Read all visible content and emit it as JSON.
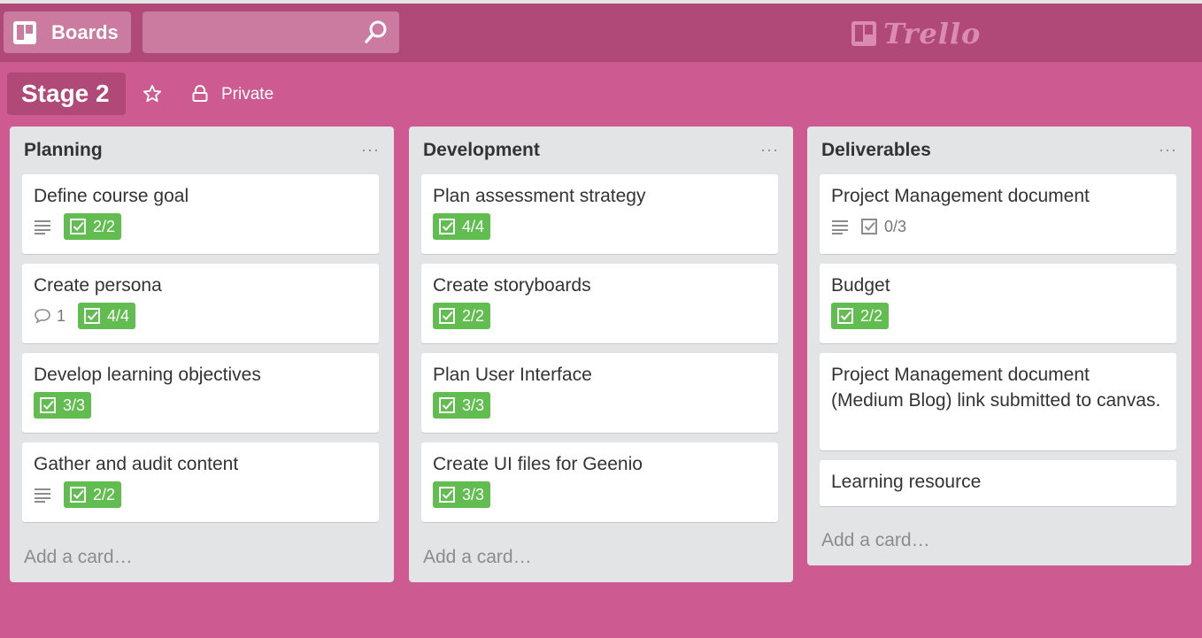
{
  "header": {
    "boards_label": "Boards",
    "search_placeholder": "",
    "logo_text": "Trello"
  },
  "board": {
    "title": "Stage 2",
    "visibility": "Private"
  },
  "colors": {
    "background": "#cd5a91",
    "header": "#b04977",
    "checklist_complete": "#61bd4f"
  },
  "lists": [
    {
      "title": "Planning",
      "menu": "···",
      "add_card": "Add a card…",
      "cards": [
        {
          "title": "Define course goal",
          "description": true,
          "checklist": "2/2",
          "complete": true
        },
        {
          "title": "Create persona",
          "comments": "1",
          "checklist": "4/4",
          "complete": true
        },
        {
          "title": "Develop learning objectives",
          "checklist": "3/3",
          "complete": true
        },
        {
          "title": "Gather and audit content",
          "description": true,
          "checklist": "2/2",
          "complete": true
        }
      ]
    },
    {
      "title": "Development",
      "menu": "···",
      "add_card": "Add a card…",
      "cards": [
        {
          "title": "Plan assessment strategy",
          "checklist": "4/4",
          "complete": true
        },
        {
          "title": "Create storyboards",
          "checklist": "2/2",
          "complete": true
        },
        {
          "title": "Plan User Interface",
          "checklist": "3/3",
          "complete": true
        },
        {
          "title": "Create UI files for Geenio",
          "checklist": "3/3",
          "complete": true
        }
      ]
    },
    {
      "title": "Deliverables",
      "menu": "···",
      "add_card": "Add a card…",
      "cards": [
        {
          "title": "Project Management document",
          "description": true,
          "checklist": "0/3",
          "complete": false
        },
        {
          "title": "Budget",
          "checklist": "2/2",
          "complete": true
        },
        {
          "title": "Project Management document (Medium Blog) link submitted to canvas."
        },
        {
          "title": "Learning resource"
        }
      ]
    }
  ]
}
